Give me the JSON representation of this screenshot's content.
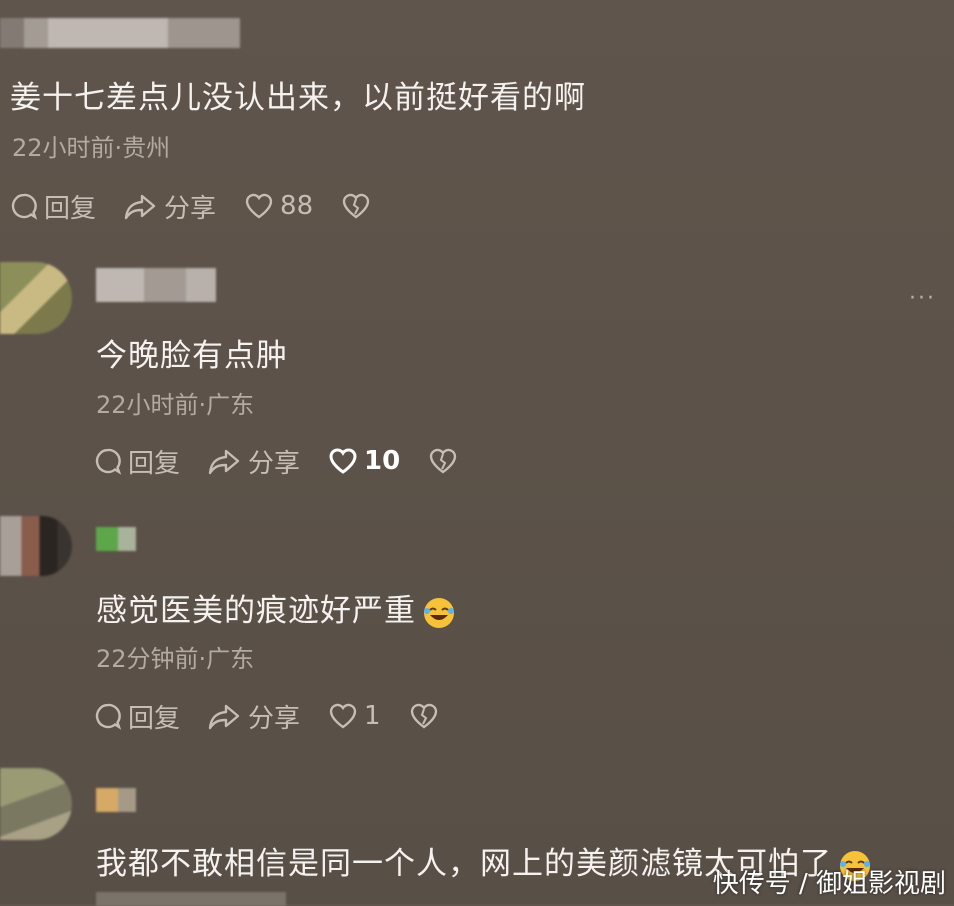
{
  "comments": [
    {
      "text": "姜十七差点儿没认出来，以前挺好看的啊",
      "meta": "22小时前·贵州",
      "reply": "回复",
      "share": "分享",
      "likes": "88"
    },
    {
      "text": "今晚脸有点肿",
      "meta": "22小时前·广东",
      "reply": "回复",
      "share": "分享",
      "likes": "10"
    },
    {
      "text": "感觉医美的痕迹好严重",
      "meta": "22分钟前·广东",
      "reply": "回复",
      "share": "分享",
      "likes": "1"
    },
    {
      "text": "我都不敢相信是同一个人，网上的美颜滤镜太可怕了"
    }
  ],
  "more_label": "···",
  "watermark": "快传号 / 御姐影视剧",
  "colors": {
    "background": "#5c5249",
    "meta_text": "#b3aaa1",
    "accent": "#ffffff"
  },
  "icons": [
    "comment-bubble-icon",
    "share-arrow-icon",
    "heart-icon",
    "broken-heart-icon",
    "laughing-emoji-icon"
  ]
}
